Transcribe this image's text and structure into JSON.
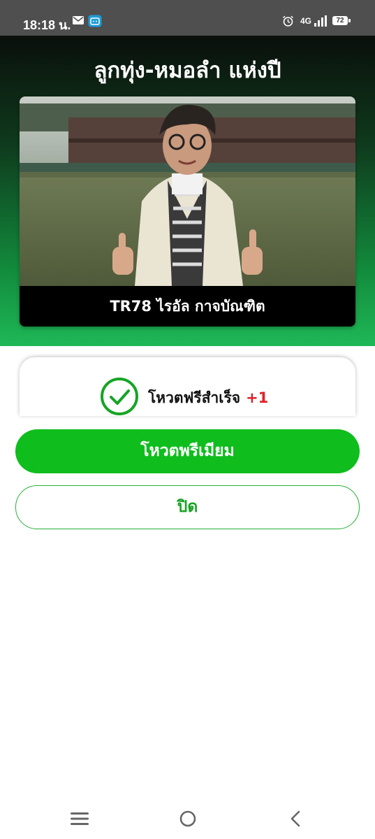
{
  "status_bar": {
    "time": "18:18 น.",
    "network": "4G",
    "battery": "72"
  },
  "hero": {
    "title": "ลูกทุ่ง-หมอลำ แห่งปี"
  },
  "candidate": {
    "name": "TR78 ไรอัล กาจบัณฑิต"
  },
  "vote_result": {
    "message": "โหวตฟรีสำเร็จ",
    "increment": "+1"
  },
  "buttons": {
    "premium_vote": "โหวตพรีเมียม",
    "close": "ปิด"
  },
  "icons": {
    "status": [
      "mail-icon",
      "app-notification-icon",
      "alarm-icon",
      "signal-icon",
      "battery-icon"
    ],
    "nav": [
      "menu-icon",
      "home-icon",
      "back-icon"
    ],
    "result": "check-circle-icon"
  },
  "colors": {
    "accent_green": "#0fbd1d",
    "increment_red": "#e0202a",
    "hero_gradient_top": "#0a0f0b",
    "hero_gradient_bottom": "#1fb857"
  }
}
